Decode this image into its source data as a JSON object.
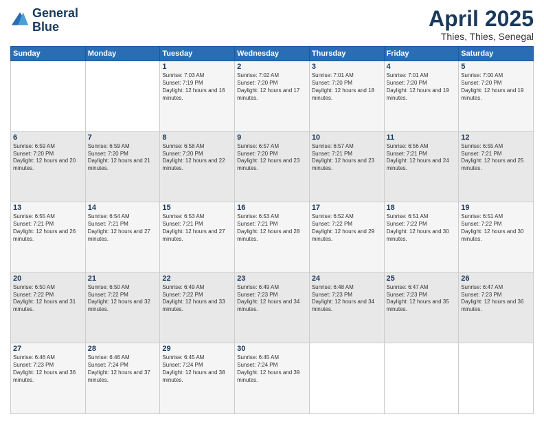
{
  "header": {
    "logo_line1": "General",
    "logo_line2": "Blue",
    "month_title": "April 2025",
    "subtitle": "Thies, Thies, Senegal"
  },
  "days_of_week": [
    "Sunday",
    "Monday",
    "Tuesday",
    "Wednesday",
    "Thursday",
    "Friday",
    "Saturday"
  ],
  "weeks": [
    [
      {
        "day": "",
        "sunrise": "",
        "sunset": "",
        "daylight": ""
      },
      {
        "day": "",
        "sunrise": "",
        "sunset": "",
        "daylight": ""
      },
      {
        "day": "1",
        "sunrise": "Sunrise: 7:03 AM",
        "sunset": "Sunset: 7:19 PM",
        "daylight": "Daylight: 12 hours and 16 minutes."
      },
      {
        "day": "2",
        "sunrise": "Sunrise: 7:02 AM",
        "sunset": "Sunset: 7:20 PM",
        "daylight": "Daylight: 12 hours and 17 minutes."
      },
      {
        "day": "3",
        "sunrise": "Sunrise: 7:01 AM",
        "sunset": "Sunset: 7:20 PM",
        "daylight": "Daylight: 12 hours and 18 minutes."
      },
      {
        "day": "4",
        "sunrise": "Sunrise: 7:01 AM",
        "sunset": "Sunset: 7:20 PM",
        "daylight": "Daylight: 12 hours and 19 minutes."
      },
      {
        "day": "5",
        "sunrise": "Sunrise: 7:00 AM",
        "sunset": "Sunset: 7:20 PM",
        "daylight": "Daylight: 12 hours and 19 minutes."
      }
    ],
    [
      {
        "day": "6",
        "sunrise": "Sunrise: 6:59 AM",
        "sunset": "Sunset: 7:20 PM",
        "daylight": "Daylight: 12 hours and 20 minutes."
      },
      {
        "day": "7",
        "sunrise": "Sunrise: 6:59 AM",
        "sunset": "Sunset: 7:20 PM",
        "daylight": "Daylight: 12 hours and 21 minutes."
      },
      {
        "day": "8",
        "sunrise": "Sunrise: 6:58 AM",
        "sunset": "Sunset: 7:20 PM",
        "daylight": "Daylight: 12 hours and 22 minutes."
      },
      {
        "day": "9",
        "sunrise": "Sunrise: 6:57 AM",
        "sunset": "Sunset: 7:20 PM",
        "daylight": "Daylight: 12 hours and 23 minutes."
      },
      {
        "day": "10",
        "sunrise": "Sunrise: 6:57 AM",
        "sunset": "Sunset: 7:21 PM",
        "daylight": "Daylight: 12 hours and 23 minutes."
      },
      {
        "day": "11",
        "sunrise": "Sunrise: 6:56 AM",
        "sunset": "Sunset: 7:21 PM",
        "daylight": "Daylight: 12 hours and 24 minutes."
      },
      {
        "day": "12",
        "sunrise": "Sunrise: 6:55 AM",
        "sunset": "Sunset: 7:21 PM",
        "daylight": "Daylight: 12 hours and 25 minutes."
      }
    ],
    [
      {
        "day": "13",
        "sunrise": "Sunrise: 6:55 AM",
        "sunset": "Sunset: 7:21 PM",
        "daylight": "Daylight: 12 hours and 26 minutes."
      },
      {
        "day": "14",
        "sunrise": "Sunrise: 6:54 AM",
        "sunset": "Sunset: 7:21 PM",
        "daylight": "Daylight: 12 hours and 27 minutes."
      },
      {
        "day": "15",
        "sunrise": "Sunrise: 6:53 AM",
        "sunset": "Sunset: 7:21 PM",
        "daylight": "Daylight: 12 hours and 27 minutes."
      },
      {
        "day": "16",
        "sunrise": "Sunrise: 6:53 AM",
        "sunset": "Sunset: 7:21 PM",
        "daylight": "Daylight: 12 hours and 28 minutes."
      },
      {
        "day": "17",
        "sunrise": "Sunrise: 6:52 AM",
        "sunset": "Sunset: 7:22 PM",
        "daylight": "Daylight: 12 hours and 29 minutes."
      },
      {
        "day": "18",
        "sunrise": "Sunrise: 6:51 AM",
        "sunset": "Sunset: 7:22 PM",
        "daylight": "Daylight: 12 hours and 30 minutes."
      },
      {
        "day": "19",
        "sunrise": "Sunrise: 6:51 AM",
        "sunset": "Sunset: 7:22 PM",
        "daylight": "Daylight: 12 hours and 30 minutes."
      }
    ],
    [
      {
        "day": "20",
        "sunrise": "Sunrise: 6:50 AM",
        "sunset": "Sunset: 7:22 PM",
        "daylight": "Daylight: 12 hours and 31 minutes."
      },
      {
        "day": "21",
        "sunrise": "Sunrise: 6:50 AM",
        "sunset": "Sunset: 7:22 PM",
        "daylight": "Daylight: 12 hours and 32 minutes."
      },
      {
        "day": "22",
        "sunrise": "Sunrise: 6:49 AM",
        "sunset": "Sunset: 7:22 PM",
        "daylight": "Daylight: 12 hours and 33 minutes."
      },
      {
        "day": "23",
        "sunrise": "Sunrise: 6:49 AM",
        "sunset": "Sunset: 7:23 PM",
        "daylight": "Daylight: 12 hours and 34 minutes."
      },
      {
        "day": "24",
        "sunrise": "Sunrise: 6:48 AM",
        "sunset": "Sunset: 7:23 PM",
        "daylight": "Daylight: 12 hours and 34 minutes."
      },
      {
        "day": "25",
        "sunrise": "Sunrise: 6:47 AM",
        "sunset": "Sunset: 7:23 PM",
        "daylight": "Daylight: 12 hours and 35 minutes."
      },
      {
        "day": "26",
        "sunrise": "Sunrise: 6:47 AM",
        "sunset": "Sunset: 7:23 PM",
        "daylight": "Daylight: 12 hours and 36 minutes."
      }
    ],
    [
      {
        "day": "27",
        "sunrise": "Sunrise: 6:46 AM",
        "sunset": "Sunset: 7:23 PM",
        "daylight": "Daylight: 12 hours and 36 minutes."
      },
      {
        "day": "28",
        "sunrise": "Sunrise: 6:46 AM",
        "sunset": "Sunset: 7:24 PM",
        "daylight": "Daylight: 12 hours and 37 minutes."
      },
      {
        "day": "29",
        "sunrise": "Sunrise: 6:45 AM",
        "sunset": "Sunset: 7:24 PM",
        "daylight": "Daylight: 12 hours and 38 minutes."
      },
      {
        "day": "30",
        "sunrise": "Sunrise: 6:45 AM",
        "sunset": "Sunset: 7:24 PM",
        "daylight": "Daylight: 12 hours and 39 minutes."
      },
      {
        "day": "",
        "sunrise": "",
        "sunset": "",
        "daylight": ""
      },
      {
        "day": "",
        "sunrise": "",
        "sunset": "",
        "daylight": ""
      },
      {
        "day": "",
        "sunrise": "",
        "sunset": "",
        "daylight": ""
      }
    ]
  ]
}
